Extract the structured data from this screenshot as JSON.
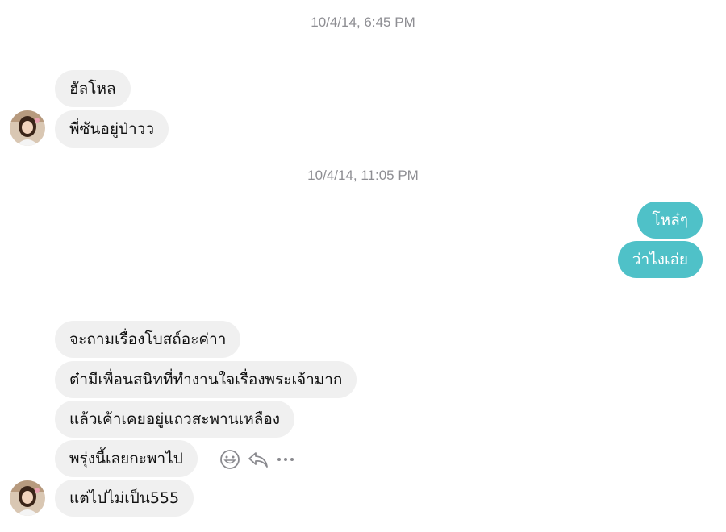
{
  "thread": {
    "timestamps": [
      "10/4/14, 6:45 PM",
      "10/4/14, 11:05 PM"
    ],
    "messages": [
      {
        "text": "ฮัลโหล",
        "direction": "incoming"
      },
      {
        "text": "พี่ซันอยู่ป่าวว",
        "direction": "incoming"
      },
      {
        "text": "โหล๋ๆ",
        "direction": "outgoing"
      },
      {
        "text": "ว่าไงเอ่ย",
        "direction": "outgoing"
      },
      {
        "text": "จะถามเรื่องโบสถ์อะค่าา",
        "direction": "incoming"
      },
      {
        "text": "ต๋ามีเพื่อนสนิทที่ทำงานใจเรื่องพระเจ้ามาก",
        "direction": "incoming"
      },
      {
        "text": "แล้วเค้าเคยอยู่แถวสะพานเหลือง",
        "direction": "incoming"
      },
      {
        "text": "พรุ่งนี้เลยกะพาไป",
        "direction": "incoming"
      },
      {
        "text": "แต่ไปไม่เป็น555",
        "direction": "incoming"
      }
    ]
  },
  "message_actions": [
    "emoji-react-icon",
    "reply-icon",
    "more-icon"
  ],
  "colors": {
    "incoming_bubble": "#f0f0f0",
    "outgoing_bubble": "#4fc1c8",
    "timestamp_text": "#8e8e93"
  }
}
